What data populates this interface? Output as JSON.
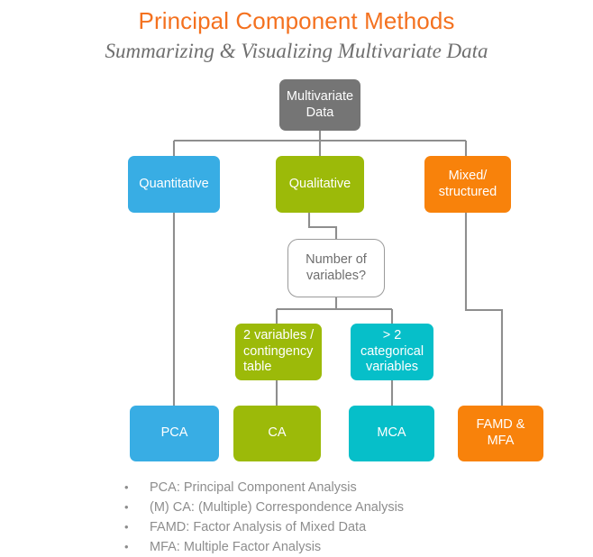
{
  "header": {
    "title": "Principal Component Methods",
    "subtitle": "Summarizing & Visualizing Multivariate Data",
    "title_color": "#f4711f",
    "subtitle_color": "#6f6f6f"
  },
  "diagram": {
    "type": "flowchart",
    "nodes": [
      {
        "id": "root",
        "label": "Multivariate\nData",
        "color": "#757575",
        "text_color": "#ffffff"
      },
      {
        "id": "quantitative",
        "label": "Quantitative",
        "color": "#38ade4",
        "text_color": "#ffffff"
      },
      {
        "id": "qualitative",
        "label": "Qualitative",
        "color": "#9cba09",
        "text_color": "#ffffff"
      },
      {
        "id": "mixed",
        "label": "Mixed/\nstructured",
        "color": "#f8820b",
        "text_color": "#ffffff"
      },
      {
        "id": "decision",
        "label": "Number of\nvariables?",
        "color": "#ffffff",
        "text_color": "#6e6e6e"
      },
      {
        "id": "two-vars",
        "label": "2 variables /\ncontingency\ntable",
        "color": "#9cba09",
        "text_color": "#ffffff"
      },
      {
        "id": "more-vars",
        "label": "> 2\ncategorical\nvariables",
        "color": "#06bfc9",
        "text_color": "#ffffff"
      },
      {
        "id": "pca",
        "label": "PCA",
        "color": "#38ade4",
        "text_color": "#ffffff"
      },
      {
        "id": "ca",
        "label": "CA",
        "color": "#9cba09",
        "text_color": "#ffffff"
      },
      {
        "id": "mca",
        "label": "MCA",
        "color": "#06bfc9",
        "text_color": "#ffffff"
      },
      {
        "id": "famd-mfa",
        "label": "FAMD &\nMFA",
        "color": "#f8820b",
        "text_color": "#ffffff"
      }
    ],
    "edges": [
      {
        "from": "root",
        "to": "quantitative"
      },
      {
        "from": "root",
        "to": "qualitative"
      },
      {
        "from": "root",
        "to": "mixed"
      },
      {
        "from": "qualitative",
        "to": "decision"
      },
      {
        "from": "decision",
        "to": "two-vars"
      },
      {
        "from": "decision",
        "to": "more-vars"
      },
      {
        "from": "quantitative",
        "to": "pca"
      },
      {
        "from": "two-vars",
        "to": "ca"
      },
      {
        "from": "more-vars",
        "to": "mca"
      },
      {
        "from": "mixed",
        "to": "famd-mfa"
      }
    ],
    "connector_color": "#8e8e8e"
  },
  "legend": {
    "bullet": "•",
    "items": [
      "PCA: Principal Component Analysis",
      "(M) CA: (Multiple) Correspondence Analysis",
      "FAMD: Factor Analysis of Mixed Data",
      "MFA: Multiple Factor Analysis"
    ],
    "text_color": "#8d8d8d"
  }
}
